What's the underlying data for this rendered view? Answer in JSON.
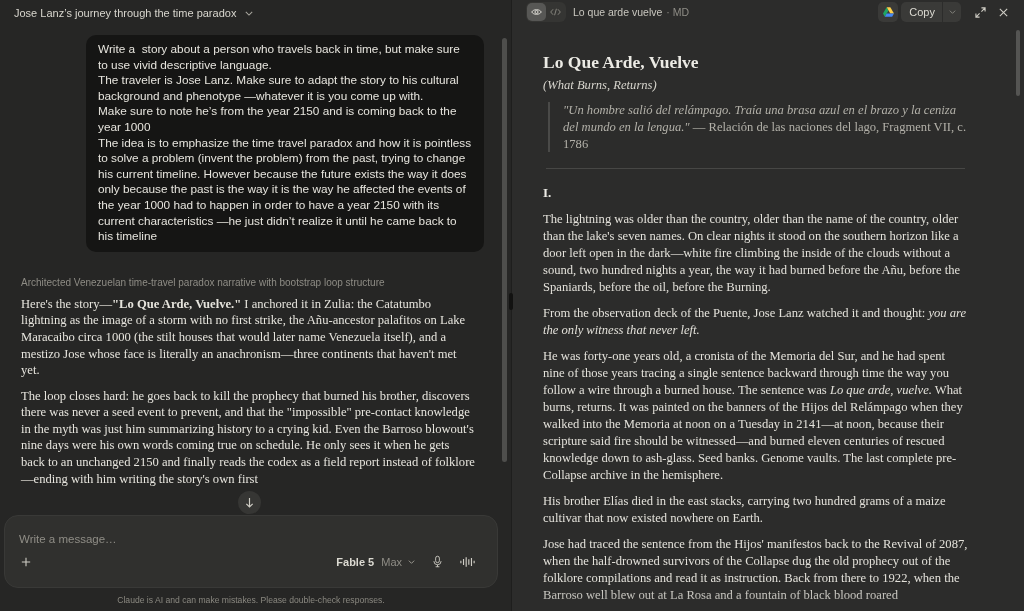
{
  "conversation": {
    "title": "Jose Lanz’s journey through the time paradox",
    "user_message": "Write a  story about a person who travels back in time, but make sure to use vivid descriptive language.\nThe traveler is Jose Lanz. Make sure to adapt the story to his cultural background and phenotype —whatever it is you come up with.\nMake sure to note he’s from the year 2150 and is coming back to the year 1000\nThe idea is to emphasize the time travel paradox and how it is pointless to solve a problem (invent the problem) from the past, trying to change his current timeline. However because the future exists the way it does only because the past is the way it is the way he affected the events of the year 1000 had to happen in order to have a year 2150 with its current characteristics —he just didn’t realize it until he came back to his timeline",
    "thinking_summary": "Architected Venezuelan time-travel paradox narrative with bootstrap loop structure",
    "response_paragraphs": [
      "Here's the story—**\"Lo Que Arde, Vuelve.\"** I anchored it in Zulia: the Catatumbo lightning as the image of a storm with no first strike, the Añu-ancestor palafitos on Lake Maracaibo circa 1000 (the stilt houses that would later name Venezuela itself), and a mestizo Jose whose face is literally an anachronism—three continents that haven't met yet.",
      "The loop closes hard: he goes back to kill the prophecy that burned his brother, discovers there was never a seed event to prevent, and that the \"impossible\" pre-contact knowledge in the myth was just him summarizing history to a crying kid. Even the Barroso blowout's nine days were his own words coming true on schedule. He only sees it when he gets back to an unchanged 2150 and finally reads the codex as a field report instead of folklore—ending with him writing the story's own first"
    ]
  },
  "composer": {
    "placeholder": "Write a message…",
    "model": "Fable 5",
    "effort": "Max"
  },
  "disclaimer": "Claude is AI and can make mistakes. Please double-check responses.",
  "artifact": {
    "view_toggle": [
      {
        "kind": "preview",
        "selected": true
      },
      {
        "kind": "code",
        "selected": false
      }
    ],
    "name": "Lo que arde vuelve",
    "format": "· MD",
    "copy_label": "Copy",
    "document": {
      "title": "Lo Que Arde, Vuelve",
      "subtitle": "(What Burns, Returns)",
      "epigraph": "*\"Un hombre salió del relámpago. Traía una brasa azul en el brazo y la ceniza del mundo en la lengua.\"* — Relación de las naciones del lago, Fragment VII, c. 1786",
      "sections": [
        {
          "heading": "I.",
          "paragraphs": [
            "The lightning was older than the country, older than the name of the country, older than the lake's seven names. On clear nights it stood on the southern horizon like a door left open in the dark—white fire climbing the inside of the clouds without a sound, two hundred nights a year, the way it had burned before the Añu, before the Spaniards, before the oil, before the Burning.",
            "From the observation deck of the Puente, Jose Lanz watched it and thought: *you are the only witness that never left.*",
            "He was forty-one years old, a cronista of the Memoria del Sur, and he had spent nine of those years tracing a single sentence backward through time the way you follow a wire through a burned house. The sentence was *Lo que arde, vuelve.* What burns, returns. It was painted on the banners of the Hijos del Relámpago when they walked into the Memoria at noon on a Tuesday in 2141—at noon, because their scripture said fire should be witnessed—and burned eleven centuries of rescued knowledge down to ash-glass. Seed banks. Genome vaults. The last complete pre-Collapse archive in the hemisphere.",
            "His brother Elías died in the east stacks, carrying two hundred grams of a maize cultivar that now existed nowhere on Earth.",
            "Jose had traced the sentence from the Hijos' manifestos back to the Revival of 2087, when the half-drowned survivors of the Collapse dug the old prophecy out of the folklore compilations and read it as instruction. Back from there to 1922, when the Barroso well blew out at La Rosa and a fountain of black blood roared"
          ]
        }
      ]
    }
  }
}
